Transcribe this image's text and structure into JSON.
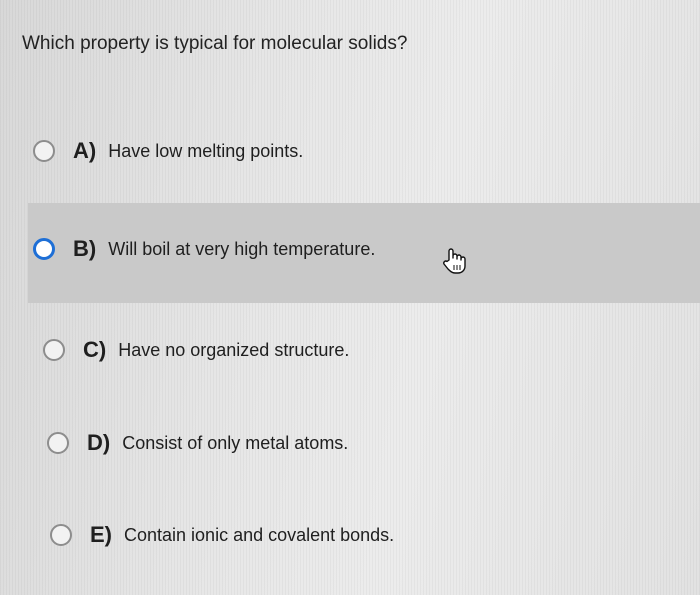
{
  "question": "Which property is typical for molecular solids?",
  "options": [
    {
      "letter": "A)",
      "text": "Have low melting points."
    },
    {
      "letter": "B)",
      "text": "Will boil at very high temperature."
    },
    {
      "letter": "C)",
      "text": "Have no organized structure."
    },
    {
      "letter": "D)",
      "text": "Consist of only metal atoms."
    },
    {
      "letter": "E)",
      "text": "Contain ionic and covalent bonds."
    }
  ],
  "hovered_option": "B)",
  "cursor_icon": "hand-pointer-icon",
  "colors": {
    "radio_hover": "#1e6fd6",
    "highlight_row": "#c9c9c9"
  }
}
